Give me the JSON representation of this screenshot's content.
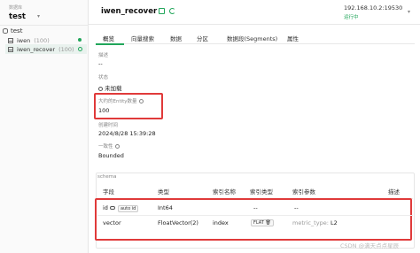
{
  "sidebar": {
    "db_caption": "数据库",
    "db_name": "test",
    "tree_root": "test",
    "collections": [
      {
        "name": "iwen",
        "count": "(100)",
        "status": "loaded"
      },
      {
        "name": "iwen_recover",
        "count": "(100)",
        "status": "unloaded"
      }
    ]
  },
  "header": {
    "collection_name": "iwen_recover",
    "connection_ip": "192.168.10.2:19530",
    "connection_status": "运行中"
  },
  "tabs": [
    "概览",
    "向量搜索",
    "数据",
    "分区",
    "数据段(Segments)",
    "属性"
  ],
  "overview": {
    "description_label": "描述",
    "description_value": "--",
    "status_label": "状态",
    "status_value": "未加载",
    "entity_label": "大约的Entity数量",
    "entity_value": "100",
    "created_label": "创建时间",
    "created_value": "2024/8/28 15:39:28",
    "consistency_label": "一致性",
    "consistency_value": "Bounded"
  },
  "schema": {
    "caption": "schema",
    "headers": [
      "字段",
      "类型",
      "索引名称",
      "索引类型",
      "索引参数",
      "描述"
    ],
    "rows": [
      {
        "field": "id",
        "badge": "auto id",
        "type": "Int64",
        "index_name": "",
        "index_type": "--",
        "index_params": "--",
        "description": ""
      },
      {
        "field": "vector",
        "badge": "",
        "type": "FloatVector(2)",
        "index_name": "index",
        "index_type": "FLAT",
        "index_params_key": "metric_type:",
        "index_params_val": "L2",
        "description": ""
      }
    ]
  },
  "watermark": "CSDN @满天点点星辰",
  "colors": {
    "accent": "#21a65a",
    "highlight": "#e03a3a"
  }
}
